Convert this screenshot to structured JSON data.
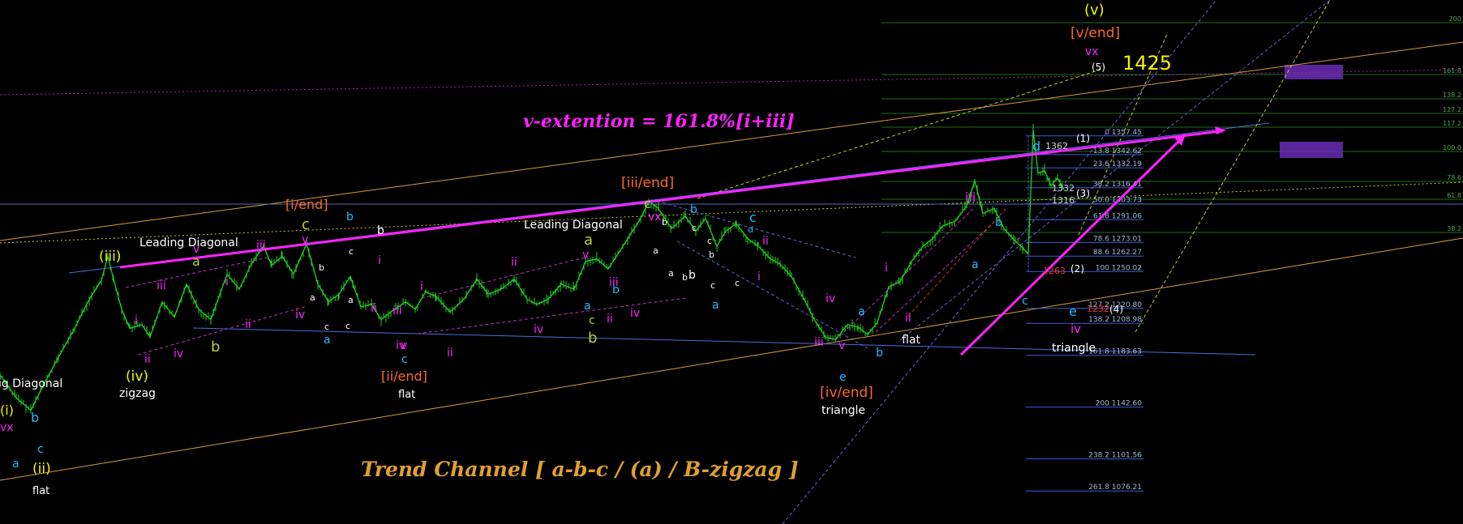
{
  "chart_data": {
    "type": "line",
    "title": "",
    "xlabel": "",
    "ylabel": "",
    "ylim": [
      1050,
      1460
    ],
    "colors": {
      "background": "#000000",
      "price": "#1fd21f",
      "magenta": "#ff22ff",
      "orange_label": "#ff6a2a",
      "yellow_label": "#f4f400",
      "cyan_label": "#22b8ff",
      "olive_label": "#b8cf3a",
      "white_label": "#ffffff",
      "channel": "#e0a040",
      "blue_line": "#4a6fd8",
      "purple_zone": "#6a2bb5"
    },
    "headlines": {
      "v_extension": "v-extention = 161.8%[i+iii]",
      "trend_channel": "Trend Channel  [ a-b-c / (a) / B-zigzag ]",
      "target": "1425"
    },
    "price_labels": {
      "p1362": "1362",
      "p1332": "1332",
      "p1316": "1316",
      "p1263": "1263",
      "p1232": "1232"
    },
    "fib_levels": [
      {
        "text": "0 1357.45",
        "price": 1357.45
      },
      {
        "text": "13.8 1342.62",
        "price": 1342.62
      },
      {
        "text": "23.6 1332.19",
        "price": 1332.19
      },
      {
        "text": "38.2 1316.41",
        "price": 1316.41
      },
      {
        "text": "50.0 1303.73",
        "price": 1303.73
      },
      {
        "text": "61.8 1291.06",
        "price": 1291.06
      },
      {
        "text": "78.6 1273.01",
        "price": 1273.01
      },
      {
        "text": "88.6 1262.27",
        "price": 1262.27
      },
      {
        "text": "100 1250.02",
        "price": 1250.02
      },
      {
        "text": "127.2 1220.80",
        "price": 1220.8
      },
      {
        "text": "138.2 1208.98",
        "price": 1208.98
      },
      {
        "text": "161.8 1183.63",
        "price": 1183.63
      },
      {
        "text": "200 1142.60",
        "price": 1142.6
      },
      {
        "text": "238.2 1101.56",
        "price": 1101.56
      },
      {
        "text": "261.8 1076.21",
        "price": 1076.21
      }
    ],
    "right_fib_labels": [
      "200",
      "161.8",
      "138.2",
      "127.2",
      "117.2",
      "100.0",
      "78.6",
      "61.8",
      "38.2"
    ],
    "wave_labels": [
      {
        "t": "ig Diagonal",
        "c": "white"
      },
      {
        "t": "vx",
        "c": "magenta"
      },
      {
        "t": "(i)",
        "c": "yellow"
      },
      {
        "t": "b",
        "c": "cyan"
      },
      {
        "t": "c",
        "c": "cyan"
      },
      {
        "t": "a",
        "c": "cyan"
      },
      {
        "t": "(ii)",
        "c": "yellow"
      },
      {
        "t": "flat",
        "c": "white"
      },
      {
        "t": "(iii)",
        "c": "yellow"
      },
      {
        "t": "i",
        "c": "magenta"
      },
      {
        "t": "ii",
        "c": "magenta"
      },
      {
        "t": "(iv)",
        "c": "yellow"
      },
      {
        "t": "zigzag",
        "c": "white"
      },
      {
        "t": "Leading Diagonal",
        "c": "white"
      },
      {
        "t": "iii",
        "c": "magenta"
      },
      {
        "t": "iv",
        "c": "magenta"
      },
      {
        "t": "a",
        "c": "olive"
      },
      {
        "t": "v",
        "c": "magenta"
      },
      {
        "t": "i",
        "c": "magenta"
      },
      {
        "t": "b",
        "c": "olive"
      },
      {
        "t": "ii",
        "c": "magenta"
      },
      {
        "t": "iii",
        "c": "magenta"
      },
      {
        "t": "[i/end]",
        "c": "orange"
      },
      {
        "t": "c",
        "c": "olive"
      },
      {
        "t": "v",
        "c": "magenta"
      },
      {
        "t": "iv",
        "c": "magenta"
      },
      {
        "t": "b",
        "c": "white"
      },
      {
        "t": "a",
        "c": "white"
      },
      {
        "t": "c",
        "c": "white"
      },
      {
        "t": "a",
        "c": "cyan"
      },
      {
        "t": "b",
        "c": "cyan"
      },
      {
        "t": "c",
        "c": "white"
      },
      {
        "t": "a",
        "c": "white"
      },
      {
        "t": "c",
        "c": "white"
      },
      {
        "t": "b",
        "c": "white"
      },
      {
        "t": "ii",
        "c": "magenta"
      },
      {
        "t": "i",
        "c": "magenta"
      },
      {
        "t": "iii",
        "c": "magenta"
      },
      {
        "t": "iv",
        "c": "magenta"
      },
      {
        "t": "v",
        "c": "magenta"
      },
      {
        "t": "c",
        "c": "cyan"
      },
      {
        "t": "[ii/end]",
        "c": "orange"
      },
      {
        "t": "flat",
        "c": "white"
      },
      {
        "t": "i",
        "c": "magenta"
      },
      {
        "t": "ii",
        "c": "magenta"
      },
      {
        "t": "Leading Diagonal",
        "c": "white"
      },
      {
        "t": "ii",
        "c": "magenta"
      },
      {
        "t": "iv",
        "c": "magenta"
      },
      {
        "t": "a",
        "c": "olive"
      },
      {
        "t": "v",
        "c": "magenta"
      },
      {
        "t": "iii",
        "c": "magenta"
      },
      {
        "t": "b",
        "c": "cyan"
      },
      {
        "t": "a",
        "c": "cyan"
      },
      {
        "t": "c",
        "c": "olive"
      },
      {
        "t": "b",
        "c": "olive"
      },
      {
        "t": "ii",
        "c": "magenta"
      },
      {
        "t": "iv",
        "c": "magenta"
      },
      {
        "t": "[iii/end]",
        "c": "orange"
      },
      {
        "t": "c",
        "c": "olive"
      },
      {
        "t": "vx",
        "c": "magenta"
      },
      {
        "t": "b",
        "c": "white"
      },
      {
        "t": "a",
        "c": "white"
      },
      {
        "t": "b",
        "c": "cyan"
      },
      {
        "t": "c",
        "c": "white"
      },
      {
        "t": "a",
        "c": "white"
      },
      {
        "t": "b",
        "c": "white"
      },
      {
        "t": "c",
        "c": "white"
      },
      {
        "t": "b",
        "c": "white"
      },
      {
        "t": "c",
        "c": "white"
      },
      {
        "t": "b",
        "c": "white"
      },
      {
        "t": "a",
        "c": "cyan"
      },
      {
        "t": "c",
        "c": "cyan"
      },
      {
        "t": "d",
        "c": "cyan"
      },
      {
        "t": "c",
        "c": "white"
      },
      {
        "t": "ii",
        "c": "magenta"
      },
      {
        "t": "i",
        "c": "magenta"
      },
      {
        "t": "iv",
        "c": "magenta"
      },
      {
        "t": "iii",
        "c": "magenta"
      },
      {
        "t": "v",
        "c": "magenta"
      },
      {
        "t": "e",
        "c": "cyan"
      },
      {
        "t": "a",
        "c": "cyan"
      },
      {
        "t": "b",
        "c": "cyan"
      },
      {
        "t": "[iv/end]",
        "c": "orange"
      },
      {
        "t": "triangle",
        "c": "white"
      },
      {
        "t": "i",
        "c": "magenta"
      },
      {
        "t": "ii",
        "c": "magenta"
      },
      {
        "t": "flat",
        "c": "white"
      },
      {
        "t": "iii",
        "c": "magenta"
      },
      {
        "t": "b",
        "c": "cyan"
      },
      {
        "t": "a",
        "c": "cyan"
      },
      {
        "t": "c",
        "c": "cyan"
      },
      {
        "t": "d",
        "c": "cyan"
      },
      {
        "t": "e",
        "c": "cyan"
      },
      {
        "t": "iv",
        "c": "magenta"
      },
      {
        "t": "triangle",
        "c": "white"
      },
      {
        "t": "(1)",
        "c": "white"
      },
      {
        "t": "(2)",
        "c": "white"
      },
      {
        "t": "(3)",
        "c": "white"
      },
      {
        "t": "(4)",
        "c": "white"
      },
      {
        "t": "(5)",
        "c": "white"
      },
      {
        "t": "(v)",
        "c": "yellow"
      },
      {
        "t": "[v/end]",
        "c": "orange"
      },
      {
        "t": "vx",
        "c": "magenta"
      }
    ],
    "price_path": [
      [
        0,
        1168
      ],
      [
        20,
        1150
      ],
      [
        38,
        1140
      ],
      [
        55,
        1162
      ],
      [
        72,
        1182
      ],
      [
        92,
        1205
      ],
      [
        110,
        1228
      ],
      [
        125,
        1243
      ],
      [
        133,
        1262
      ],
      [
        140,
        1244
      ],
      [
        150,
        1220
      ],
      [
        160,
        1205
      ],
      [
        175,
        1208
      ],
      [
        185,
        1198
      ],
      [
        200,
        1226
      ],
      [
        215,
        1214
      ],
      [
        230,
        1240
      ],
      [
        245,
        1220
      ],
      [
        260,
        1212
      ],
      [
        280,
        1248
      ],
      [
        295,
        1236
      ],
      [
        310,
        1256
      ],
      [
        325,
        1270
      ],
      [
        335,
        1255
      ],
      [
        348,
        1262
      ],
      [
        362,
        1248
      ],
      [
        378,
        1272
      ],
      [
        392,
        1240
      ],
      [
        405,
        1226
      ],
      [
        418,
        1232
      ],
      [
        432,
        1246
      ],
      [
        445,
        1222
      ],
      [
        458,
        1224
      ],
      [
        470,
        1212
      ],
      [
        482,
        1218
      ],
      [
        500,
        1226
      ],
      [
        512,
        1220
      ],
      [
        525,
        1234
      ],
      [
        538,
        1230
      ],
      [
        555,
        1218
      ],
      [
        572,
        1228
      ],
      [
        588,
        1244
      ],
      [
        602,
        1232
      ],
      [
        618,
        1236
      ],
      [
        634,
        1244
      ],
      [
        650,
        1228
      ],
      [
        662,
        1224
      ],
      [
        676,
        1228
      ],
      [
        692,
        1240
      ],
      [
        708,
        1236
      ],
      [
        722,
        1258
      ],
      [
        736,
        1260
      ],
      [
        750,
        1252
      ],
      [
        762,
        1264
      ],
      [
        776,
        1278
      ],
      [
        790,
        1292
      ],
      [
        800,
        1306
      ],
      [
        812,
        1300
      ],
      [
        828,
        1284
      ],
      [
        845,
        1294
      ],
      [
        858,
        1282
      ],
      [
        870,
        1292
      ],
      [
        884,
        1270
      ],
      [
        895,
        1282
      ],
      [
        908,
        1288
      ],
      [
        922,
        1276
      ],
      [
        935,
        1270
      ],
      [
        950,
        1260
      ],
      [
        962,
        1256
      ],
      [
        976,
        1246
      ],
      [
        990,
        1230
      ],
      [
        1004,
        1212
      ],
      [
        1018,
        1198
      ],
      [
        1030,
        1196
      ],
      [
        1045,
        1208
      ],
      [
        1058,
        1206
      ],
      [
        1070,
        1200
      ],
      [
        1082,
        1210
      ],
      [
        1096,
        1238
      ],
      [
        1110,
        1242
      ],
      [
        1124,
        1258
      ],
      [
        1138,
        1270
      ],
      [
        1150,
        1276
      ],
      [
        1162,
        1286
      ],
      [
        1178,
        1290
      ],
      [
        1192,
        1302
      ],
      [
        1202,
        1322
      ],
      [
        1212,
        1296
      ],
      [
        1226,
        1300
      ],
      [
        1238,
        1284
      ],
      [
        1252,
        1274
      ],
      [
        1262,
        1268
      ],
      [
        1268,
        1264
      ],
      [
        1274,
        1362
      ],
      [
        1280,
        1328
      ],
      [
        1288,
        1330
      ],
      [
        1296,
        1318
      ],
      [
        1304,
        1324
      ],
      [
        1312,
        1315
      ]
    ]
  }
}
